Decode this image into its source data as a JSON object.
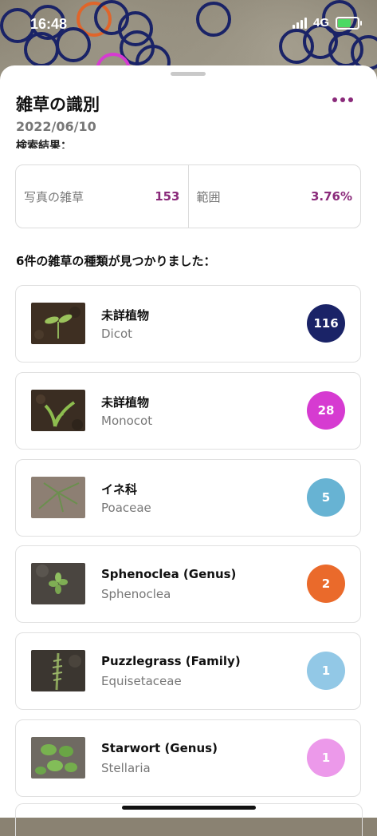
{
  "status": {
    "time": "16:48",
    "network": "4G"
  },
  "header": {
    "title": "雑草の識別",
    "date": "2022/06/10",
    "section_label": "検索結果："
  },
  "stats": [
    {
      "label": "写真の雑草",
      "value": "153"
    },
    {
      "label": "範囲",
      "value": "3.76%"
    }
  ],
  "found_text": "6件の雑草の種類が見つかりました：",
  "weeds": [
    {
      "name": "未詳植物",
      "scientific": "Dicot",
      "count": "116",
      "color": "#1a2367",
      "thumb": "dicot"
    },
    {
      "name": "未詳植物",
      "scientific": "Monocot",
      "count": "28",
      "color": "#d63bd1",
      "thumb": "monocot"
    },
    {
      "name": "イネ科",
      "scientific": "Poaceae",
      "count": "5",
      "color": "#67b3d3",
      "thumb": "poaceae"
    },
    {
      "name": "Sphenoclea (Genus)",
      "scientific": "Sphenoclea",
      "count": "2",
      "color": "#ea6a2b",
      "thumb": "sphenoclea"
    },
    {
      "name": "Puzzlegrass (Family)",
      "scientific": "Equisetaceae",
      "count": "1",
      "color": "#92c8e6",
      "thumb": "equisetaceae"
    },
    {
      "name": "Starwort (Genus)",
      "scientific": "Stellaria",
      "count": "1",
      "color": "#ec99ea",
      "thumb": "stellaria"
    }
  ],
  "colors": {
    "accent": "#8a2a7a"
  }
}
